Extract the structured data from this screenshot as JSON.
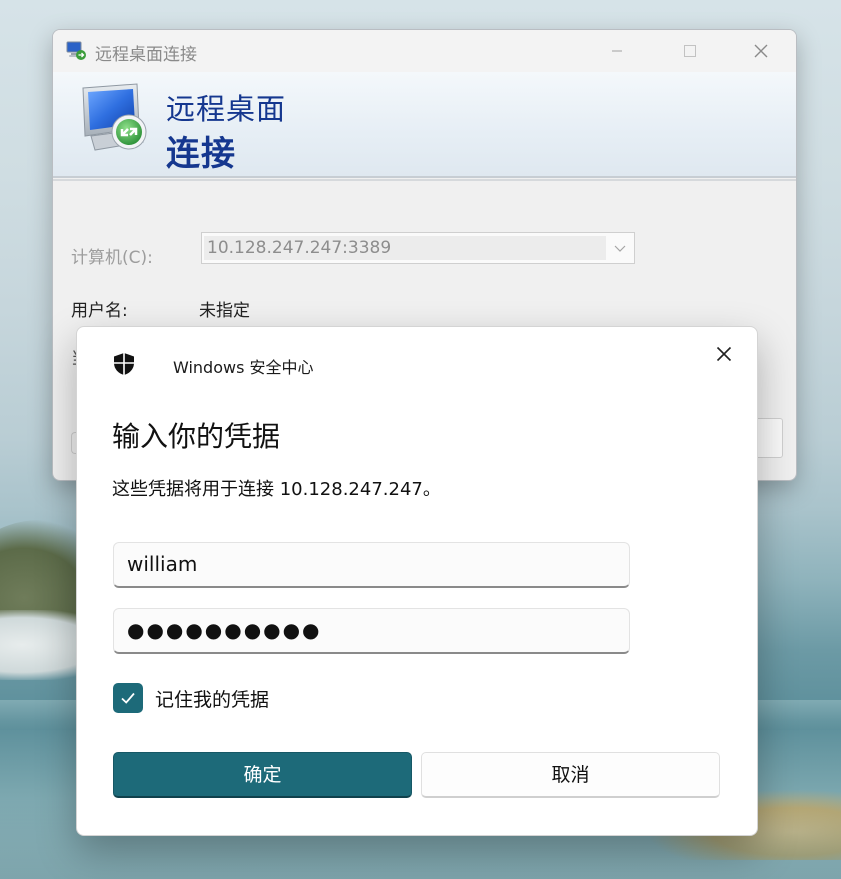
{
  "rdp_window": {
    "title": "远程桌面连接",
    "banner_line1": "远程桌面",
    "banner_line2": "连接",
    "computer_label": "计算机(C):",
    "computer_value": "10.128.247.247:3389",
    "username_label": "用户名:",
    "username_value": "未指定",
    "partial_label": "当"
  },
  "credential_dialog": {
    "app_name": "Windows 安全中心",
    "heading": "输入你的凭据",
    "description": "这些凭据将用于连接 10.128.247.247。",
    "username_value": "william",
    "password_mask": "●●●●●●●●●●",
    "remember_label": "记住我的凭据",
    "remember_checked": true,
    "ok_label": "确定",
    "cancel_label": "取消"
  },
  "colors": {
    "accent": "#1d6a79",
    "banner_text": "#15378f"
  },
  "icons": {
    "rdp_title": "remote-desktop-icon",
    "rdp_logo": "remote-desktop-logo-icon",
    "shield": "shield-icon",
    "close": "close-icon",
    "minimize": "minimize-icon",
    "maximize": "maximize-icon",
    "dropdown": "chevron-down-icon",
    "check": "checkmark-icon"
  }
}
